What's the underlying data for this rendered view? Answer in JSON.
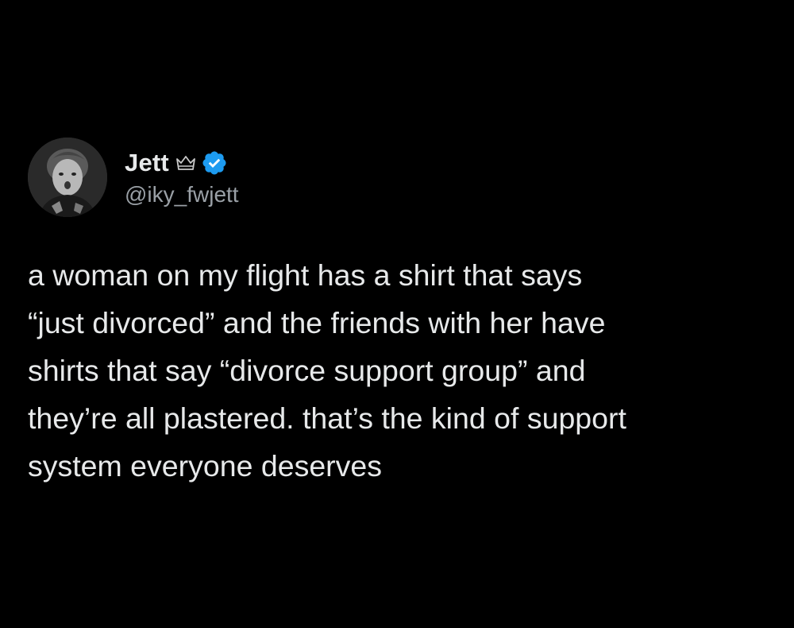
{
  "tweet": {
    "author": {
      "display_name": "Jett",
      "handle": "@iky_fwjett",
      "avatar_icon": "profile-photo",
      "badges": [
        "crown-icon",
        "verified-badge-icon"
      ],
      "verified_color": "#1d9bf0"
    },
    "lines": [
      "a woman on my flight has a shirt that says",
      "“just divorced” and the friends with her have",
      "shirts that say “divorce support group” and",
      "they’re all plastered. that’s the kind of support",
      "system everyone deserves"
    ]
  },
  "colors": {
    "background": "#000000",
    "text": "#e7e9ea",
    "secondary_text": "#9aa0a6"
  }
}
